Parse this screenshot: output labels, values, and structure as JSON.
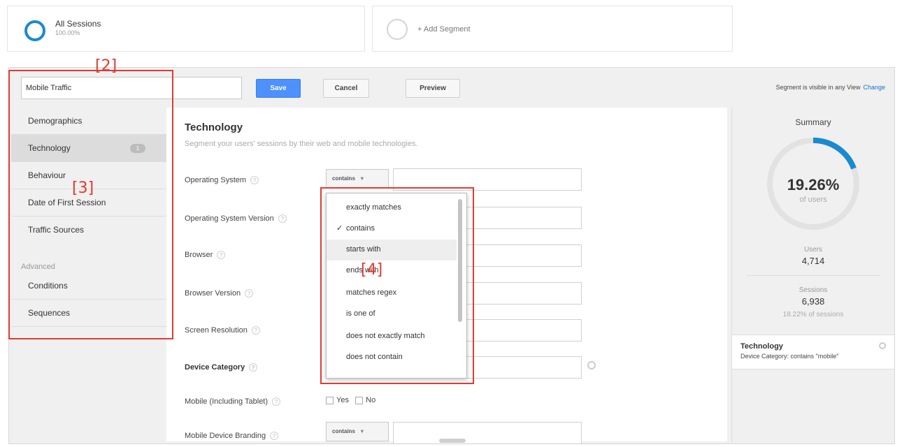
{
  "segments": [
    {
      "title": "All Sessions",
      "subtitle": "100.00%"
    },
    {
      "title": "+ Add Segment"
    }
  ],
  "toolbar": {
    "segment_name": "Mobile Traffic",
    "save_label": "Save",
    "cancel_label": "Cancel",
    "preview_label": "Preview",
    "visibility_text": "Segment is visible in any View",
    "change_label": "Change"
  },
  "nav": {
    "items": [
      {
        "label": "Demographics"
      },
      {
        "label": "Technology",
        "badge": "1"
      },
      {
        "label": "Behaviour"
      },
      {
        "label": "Date of First Session"
      },
      {
        "label": "Traffic Sources"
      }
    ],
    "advanced_heading": "Advanced",
    "advanced_items": [
      {
        "label": "Conditions"
      },
      {
        "label": "Sequences"
      }
    ]
  },
  "content": {
    "title": "Technology",
    "subtitle": "Segment your users' sessions by their web and mobile technologies.",
    "rows": [
      {
        "label": "Operating System",
        "operator": "contains"
      },
      {
        "label": "Operating System Version"
      },
      {
        "label": "Browser"
      },
      {
        "label": "Browser Version"
      },
      {
        "label": "Screen Resolution"
      },
      {
        "label": "Device Category"
      },
      {
        "label": "Mobile (Including Tablet)"
      },
      {
        "label": "Mobile Device Branding",
        "operator": "contains"
      }
    ],
    "help_glyph": "?",
    "select_arrow": "▾",
    "yes_label": "Yes",
    "no_label": "No"
  },
  "dropdown": {
    "selected": "contains",
    "hovered": "starts with",
    "options": [
      "exactly matches",
      "contains",
      "starts with",
      "ends with",
      "matches regex",
      "is one of",
      "does not exactly match",
      "does not contain"
    ],
    "check_glyph": "✓"
  },
  "summary": {
    "title": "Summary",
    "percent": "19.26%",
    "percent_value": 0.1926,
    "of_label": "of users",
    "users_label": "Users",
    "users_value": "4,714",
    "sessions_label": "Sessions",
    "sessions_value": "6,938",
    "sessions_note": "18.22% of sessions",
    "condition_title": "Technology",
    "condition_text": "Device Category: contains \"mobile\""
  },
  "annotations": {
    "box2": "[2]",
    "box3": "[3]",
    "box4": "[4]"
  },
  "colors": {
    "accent": "#1a8ad0",
    "save_button": "#4d90fe",
    "annotation": "#e03c31",
    "link": "#1a6fc9"
  }
}
